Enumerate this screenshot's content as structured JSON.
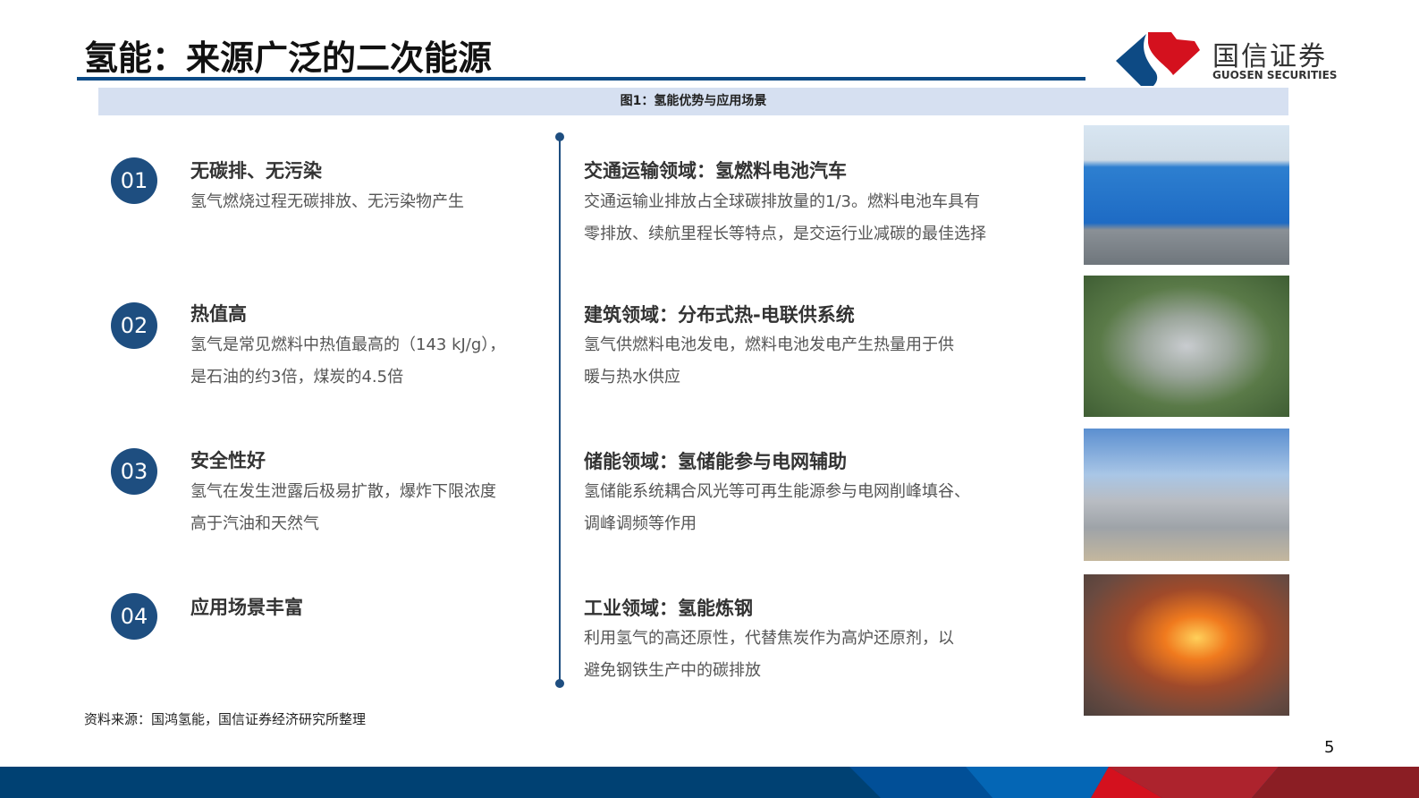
{
  "title": "氢能：来源广泛的二次能源",
  "logo": {
    "cn": "国信证券",
    "en": "GUOSEN SECURITIES"
  },
  "caption": "图1：氢能优势与应用场景",
  "advantages": [
    {
      "num": "01",
      "title": "无碳排、无污染",
      "lines": [
        "氢气燃烧过程无碳排放、无污染物产生"
      ]
    },
    {
      "num": "02",
      "title": "热值高",
      "lines": [
        "氢气是常见燃料中热值最高的（143 kJ/g），",
        "是石油的约3倍，煤炭的4.5倍"
      ]
    },
    {
      "num": "03",
      "title": "安全性好",
      "lines": [
        "氢气在发生泄露后极易扩散，爆炸下限浓度",
        "高于汽油和天然气"
      ]
    },
    {
      "num": "04",
      "title": "应用场景丰富",
      "lines": []
    }
  ],
  "applications": [
    {
      "title": "交通运输领域：氢燃料电池汽车",
      "lines": [
        "交通运输业排放占全球碳排放量的1/3。燃料电池车具有",
        "零排放、续航里程长等特点，是交运行业减碳的最佳选择"
      ]
    },
    {
      "title": "建筑领域：分布式热-电联供系统",
      "lines": [
        "氢气供燃料电池发电，燃料电池发电产生热量用于供",
        "暖与热水供应"
      ]
    },
    {
      "title": "储能领域：氢储能参与电网辅助",
      "lines": [
        "氢储能系统耦合风光等可再生能源参与电网削峰填谷、",
        "调峰调频等作用"
      ]
    },
    {
      "title": "工业领域：氢能炼钢",
      "lines": [
        "利用氢气的高还原性，代替焦炭作为高炉还原剂，以",
        "避免钢铁生产中的碳排放"
      ]
    }
  ],
  "source": "资料来源：国鸿氢能，国信证券经济研究所整理",
  "page": "5"
}
